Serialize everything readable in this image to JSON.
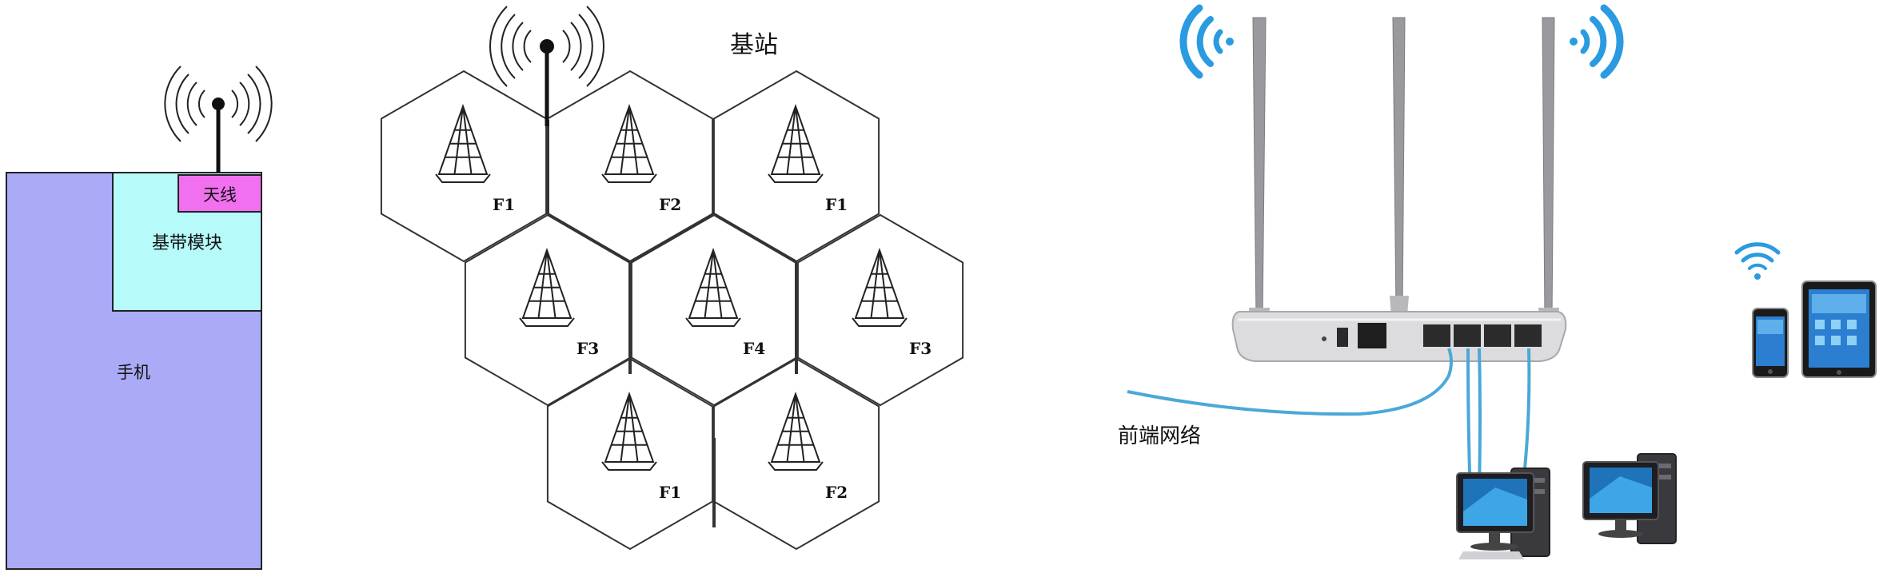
{
  "phone_diagram": {
    "phone_label": "手机",
    "baseband_label": "基带模块",
    "antenna_label": "天线",
    "colors": {
      "phone": "#aaaaf6",
      "baseband": "#b6fafa",
      "antenna": "#f070f0"
    }
  },
  "cell_diagram": {
    "title": "基站",
    "cells": [
      {
        "id": "top-left",
        "label": "F1"
      },
      {
        "id": "top-center",
        "label": "F2"
      },
      {
        "id": "top-right",
        "label": "F1"
      },
      {
        "id": "mid-left",
        "label": "F3"
      },
      {
        "id": "mid-center",
        "label": "F4"
      },
      {
        "id": "mid-right",
        "label": "F3"
      },
      {
        "id": "bottom-left",
        "label": "F1"
      },
      {
        "id": "bottom-right",
        "label": "F2"
      }
    ]
  },
  "router_diagram": {
    "network_label": "前端网络",
    "colors": {
      "wifi": "#2a9be0",
      "cable": "#4aa8d8"
    }
  }
}
